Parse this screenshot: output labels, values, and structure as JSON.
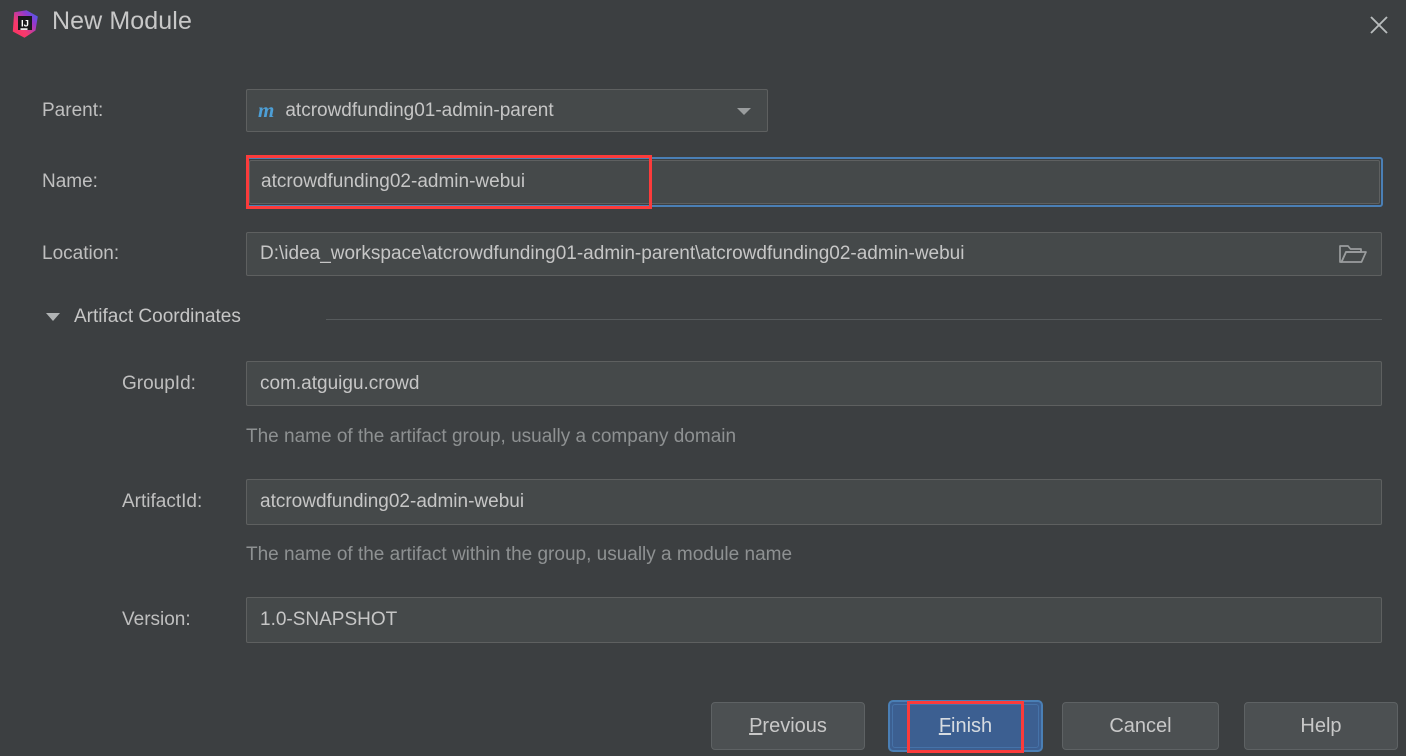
{
  "window": {
    "title": "New Module",
    "app_icon": "intellij-idea-logo",
    "close_icon": "close-icon",
    "background_color": "#3c3f41"
  },
  "form": {
    "parent": {
      "label": "Parent:",
      "value": "atcrowdfunding01-admin-parent",
      "icon": "maven-module-icon",
      "icon_glyph": "m",
      "icon_color": "#4d9fd6",
      "dropdown_icon": "chevron-down-icon"
    },
    "name": {
      "label": "Name:",
      "value": "atcrowdfunding02-admin-webui",
      "focused": true,
      "focus_color": "#4a7fb5"
    },
    "location": {
      "label": "Location:",
      "value": "D:\\idea_workspace\\atcrowdfunding01-admin-parent\\atcrowdfunding02-admin-webui",
      "browse_icon": "folder-icon"
    }
  },
  "artifact_coordinates": {
    "section_label": "Artifact Coordinates",
    "expanded": true,
    "collapse_icon": "triangle-down-icon",
    "group_id": {
      "label": "GroupId:",
      "value": "com.atguigu.crowd",
      "hint": "The name of the artifact group, usually a company domain"
    },
    "artifact_id": {
      "label": "ArtifactId:",
      "value": "atcrowdfunding02-admin-webui",
      "hint": "The name of the artifact within the group, usually a module name"
    },
    "version": {
      "label": "Version:",
      "value": "1.0-SNAPSHOT"
    }
  },
  "buttons": {
    "previous": {
      "mnemonic": "P",
      "rest": "revious"
    },
    "finish": {
      "mnemonic": "F",
      "rest": "inish",
      "is_default": true,
      "color": "#3c5f91"
    },
    "cancel": {
      "label": "Cancel"
    },
    "help": {
      "label": "Help"
    }
  },
  "annotations": {
    "color": "#fb3b3b",
    "highlights": [
      "name-field",
      "finish-button"
    ]
  }
}
